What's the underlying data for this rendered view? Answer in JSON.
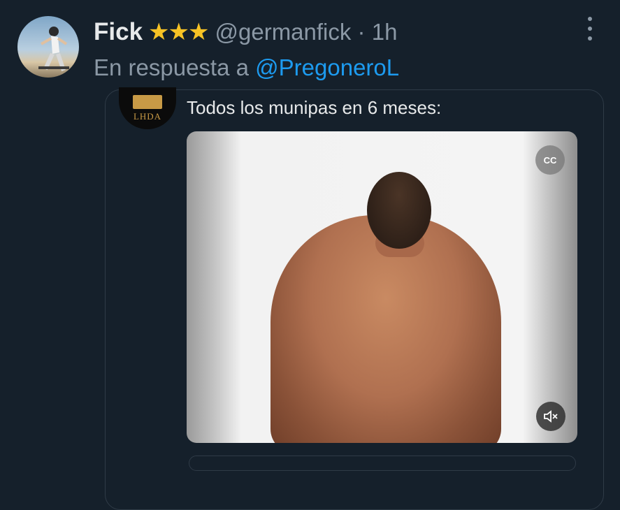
{
  "tweet": {
    "display_name": "Fick",
    "badge_stars": "★★★",
    "handle_time": "@germanfick · 1h",
    "reply_prefix": "En respuesta a",
    "reply_to": "@PregoneroL"
  },
  "quoted": {
    "avatar_text": "LHDA",
    "text": "Todos los munipas en 6 meses:"
  },
  "media_controls": {
    "captions_icon": "closed-captions-off-icon",
    "captions_glyph": "CC",
    "mute_icon": "volume-muted-icon"
  },
  "colors": {
    "background": "#15202b",
    "secondary_text": "#8b98a5",
    "link": "#1d9bf0",
    "stars": "#f7c325"
  }
}
